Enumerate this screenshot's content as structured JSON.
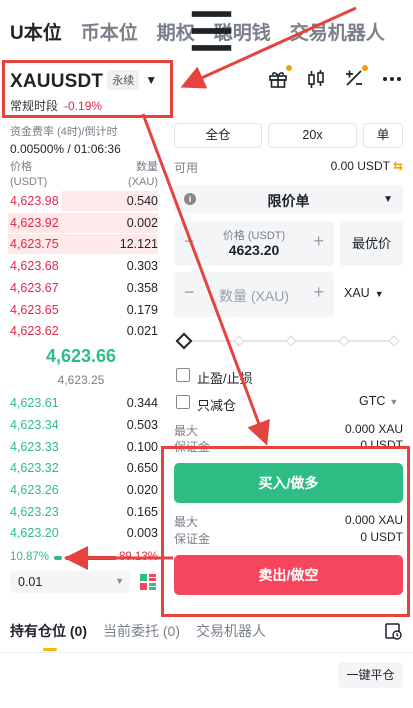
{
  "top_tabs": [
    "U本位",
    "币本位",
    "期权",
    "聪明钱",
    "交易机器人"
  ],
  "symbol": {
    "name": "XAUUSDT",
    "badge": "永续",
    "session": "常规时段",
    "change": "-0.19%"
  },
  "funding": {
    "label": "资金费率 (4时)/倒计时",
    "value": "0.00500% / 01:06:36"
  },
  "orderbook": {
    "price_header": [
      "价格",
      "(USDT)"
    ],
    "qty_header": [
      "数量",
      "(XAU)"
    ],
    "asks": [
      {
        "price": "4,623.98",
        "qty": "0.540"
      },
      {
        "price": "4,623.92",
        "qty": "0.002"
      },
      {
        "price": "4,623.75",
        "qty": "12.121"
      },
      {
        "price": "4,623.68",
        "qty": "0.303"
      },
      {
        "price": "4,623.67",
        "qty": "0.358"
      },
      {
        "price": "4,623.65",
        "qty": "0.179"
      },
      {
        "price": "4,623.62",
        "qty": "0.021"
      }
    ],
    "last_price": "4,623.66",
    "mark_price": "4,623.25",
    "bids": [
      {
        "price": "4,623.61",
        "qty": "0.344"
      },
      {
        "price": "4,623.34",
        "qty": "0.503"
      },
      {
        "price": "4,623.33",
        "qty": "0.100"
      },
      {
        "price": "4,623.32",
        "qty": "0.650"
      },
      {
        "price": "4,623.26",
        "qty": "0.020"
      },
      {
        "price": "4,623.23",
        "qty": "0.165"
      },
      {
        "price": "4,623.20",
        "qty": "0.003"
      }
    ],
    "buy_ratio": "10.87%",
    "sell_ratio": "89.13%",
    "precision": "0.01"
  },
  "order_panel": {
    "margin_mode": "全仓",
    "leverage": "20x",
    "position_mode": "单",
    "available_label": "可用",
    "available_value": "0.00 USDT",
    "order_type": "限价单",
    "price_label": "价格 (USDT)",
    "price_value": "4623.20",
    "best_price": "最优价",
    "qty_placeholder": "数量 (XAU)",
    "qty_unit": "XAU",
    "tpsl": "止盈/止损",
    "reduce_only": "只减仓",
    "tif": "GTC",
    "buy_max_label": "最大",
    "buy_max_value": "0.000 XAU",
    "buy_margin_label": "保证金",
    "buy_margin_value": "0 USDT",
    "buy_button": "买入/做多",
    "sell_max_label": "最大",
    "sell_max_value": "0.000 XAU",
    "sell_margin_label": "保证金",
    "sell_margin_value": "0 USDT",
    "sell_button": "卖出/做空"
  },
  "bottom_tabs": [
    "持有仓位 (0)",
    "当前委托 (0)",
    "交易机器人"
  ],
  "close_all": "一键平仓",
  "colors": {
    "buy": "#2ebd85",
    "sell": "#f6465d",
    "annotation": "#e6433f",
    "accent": "#f0b90b"
  }
}
